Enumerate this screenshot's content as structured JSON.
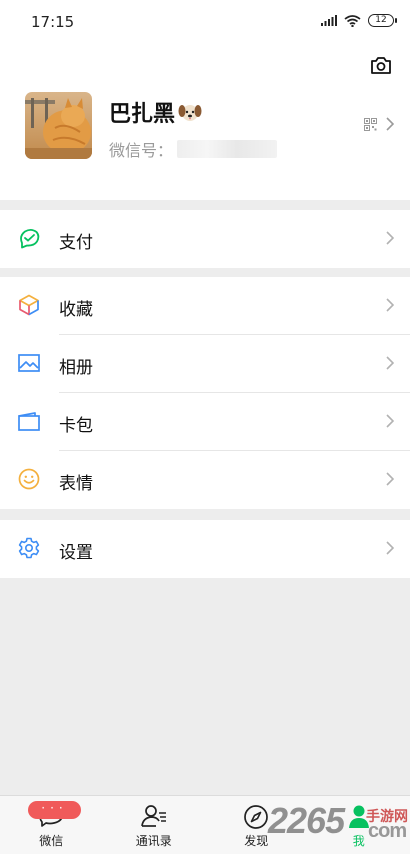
{
  "status_bar": {
    "time": "17:15",
    "battery": "12"
  },
  "profile": {
    "name": "巴扎黑",
    "wechat_id_label": "微信号："
  },
  "menu": {
    "pay": "支付",
    "favorites": "收藏",
    "album": "相册",
    "cards": "卡包",
    "stickers": "表情",
    "settings": "设置"
  },
  "tabbar": {
    "tabs": [
      {
        "label": "微信",
        "badge": "···"
      },
      {
        "label": "通讯录"
      },
      {
        "label": "发现"
      },
      {
        "label": "我"
      }
    ]
  },
  "watermark": {
    "brand": "2265",
    "suffix": "手游网",
    "tld": "com"
  },
  "colors": {
    "accent": "#07c160",
    "badge": "#f05a5a",
    "background": "#ededed"
  }
}
